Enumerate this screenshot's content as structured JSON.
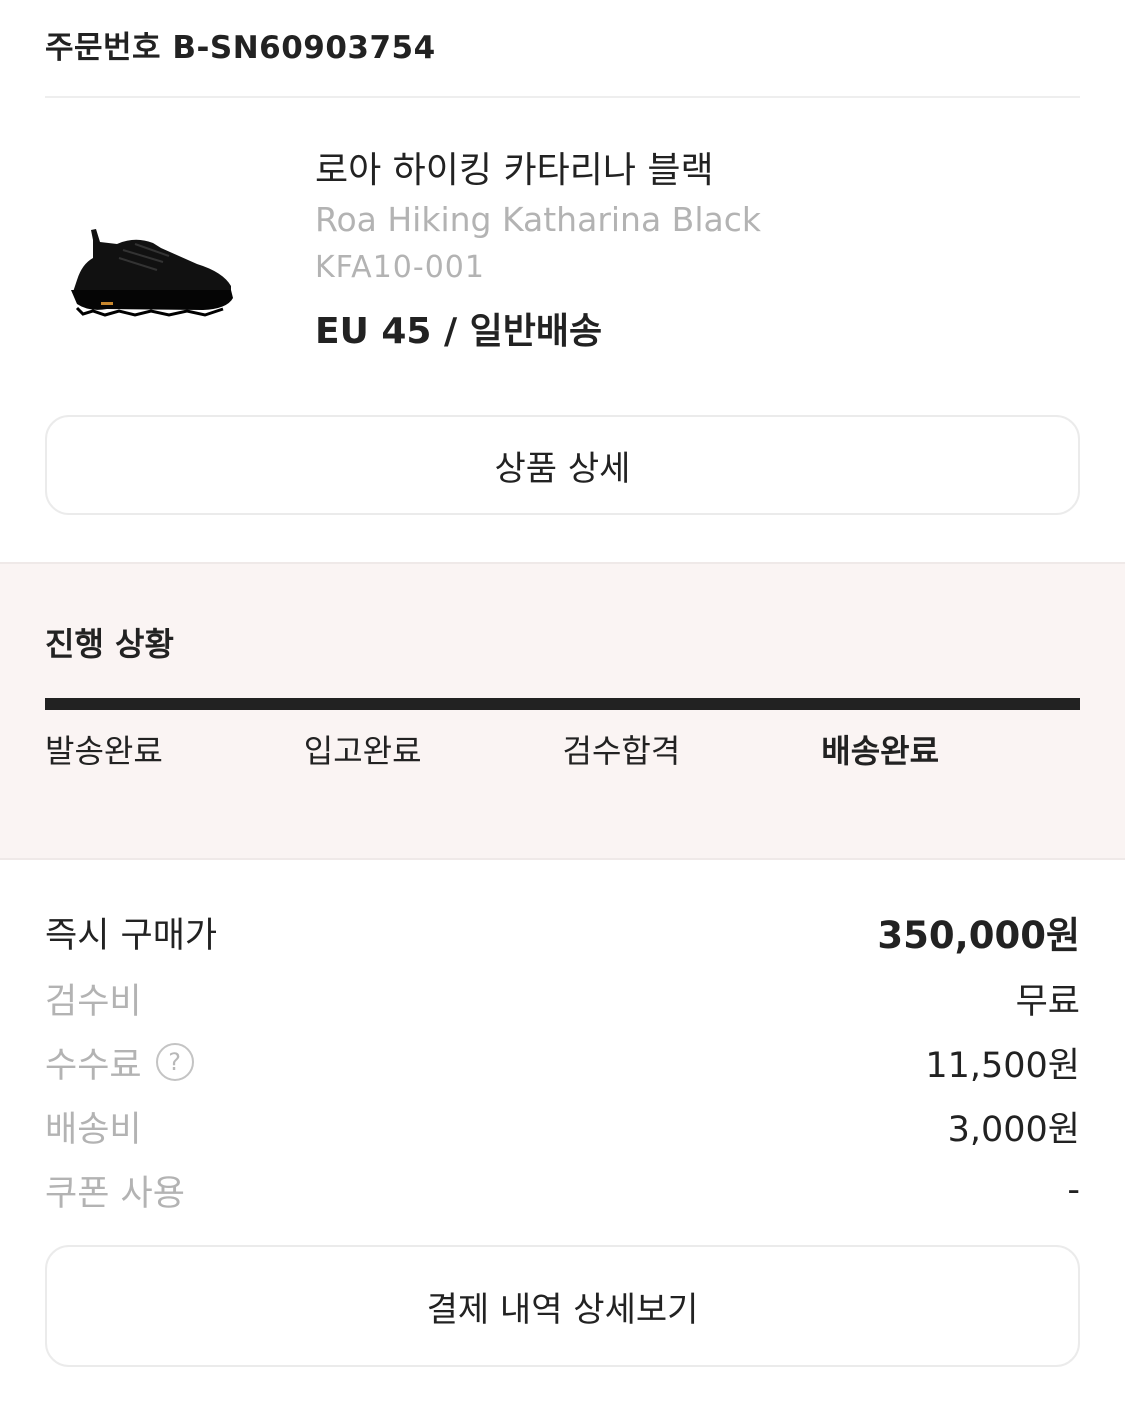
{
  "order": {
    "number": "주문번호 B-SN60903754"
  },
  "product": {
    "name_ko": "로아 하이킹 카타리나 블랙",
    "name_en": "Roa Hiking Katharina Black",
    "model": "KFA10-001",
    "size_delivery": "EU 45 / 일반배송",
    "detail_button": "상품 상세",
    "image_icon": "sneaker-image"
  },
  "progress": {
    "title": "진행 상황",
    "steps": [
      "발송완료",
      "입고완료",
      "검수합격",
      "배송완료"
    ],
    "active_step": 3,
    "value": 1.0
  },
  "prices": {
    "buy_now": {
      "label": "즉시 구매가",
      "value": "350,000원"
    },
    "inspection": {
      "label": "검수비",
      "value": "무료"
    },
    "fee": {
      "label": "수수료",
      "value": "11,500원",
      "help": "?"
    },
    "shipping": {
      "label": "배송비",
      "value": "3,000원"
    },
    "coupon": {
      "label": "쿠폰 사용",
      "value": "-"
    }
  },
  "payment_button": "결제 내역 상세보기",
  "colors": {
    "progress_bg": "#faf4f3",
    "accent": "#222222",
    "muted": "#b3b3b3"
  }
}
